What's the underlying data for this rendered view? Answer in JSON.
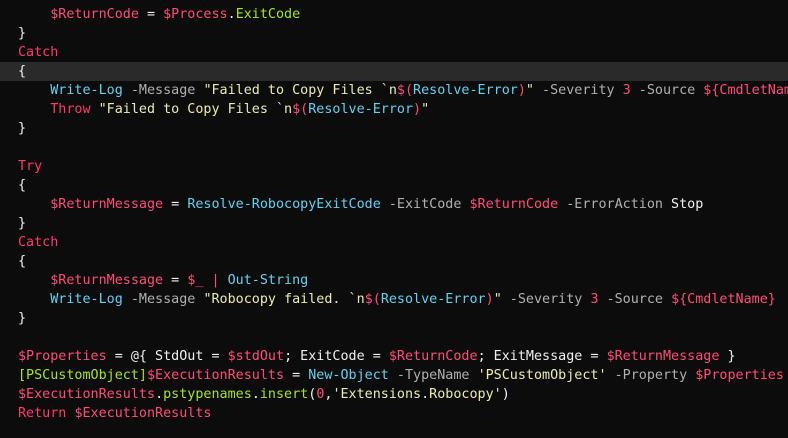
{
  "editor": {
    "current_line": 3,
    "lines": [
      [
        {
          "t": "    ",
          "c": "txt"
        },
        {
          "t": "$ReturnCode",
          "c": "var"
        },
        {
          "t": " = ",
          "c": "txt"
        },
        {
          "t": "$Process",
          "c": "var"
        },
        {
          "t": ".",
          "c": "txt"
        },
        {
          "t": "ExitCode",
          "c": "prop"
        }
      ],
      [
        {
          "t": "}",
          "c": "txt"
        }
      ],
      [
        {
          "t": "Catch",
          "c": "kw"
        }
      ],
      [
        {
          "t": "{",
          "c": "txt"
        }
      ],
      [
        {
          "t": "    ",
          "c": "txt"
        },
        {
          "t": "Write-Log",
          "c": "cmd"
        },
        {
          "t": " -Message ",
          "c": "prm"
        },
        {
          "t": "\"Failed to Copy Files `n",
          "c": "str"
        },
        {
          "t": "$(",
          "c": "strvar"
        },
        {
          "t": "Resolve-Error",
          "c": "strcmd"
        },
        {
          "t": ")",
          "c": "strvar"
        },
        {
          "t": "\"",
          "c": "str"
        },
        {
          "t": " -Severity ",
          "c": "prm"
        },
        {
          "t": "3",
          "c": "num"
        },
        {
          "t": " -Source ",
          "c": "prm"
        },
        {
          "t": "${CmdletName}",
          "c": "var"
        }
      ],
      [
        {
          "t": "    ",
          "c": "txt"
        },
        {
          "t": "Throw",
          "c": "kw"
        },
        {
          "t": " ",
          "c": "txt"
        },
        {
          "t": "\"Failed to Copy Files `n",
          "c": "str"
        },
        {
          "t": "$(",
          "c": "strvar"
        },
        {
          "t": "Resolve-Error",
          "c": "strcmd"
        },
        {
          "t": ")",
          "c": "strvar"
        },
        {
          "t": "\"",
          "c": "str"
        }
      ],
      [
        {
          "t": "}",
          "c": "txt"
        }
      ],
      [],
      [
        {
          "t": "Try",
          "c": "kw"
        }
      ],
      [
        {
          "t": "{",
          "c": "txt"
        }
      ],
      [
        {
          "t": "    ",
          "c": "txt"
        },
        {
          "t": "$ReturnMessage",
          "c": "var"
        },
        {
          "t": " = ",
          "c": "txt"
        },
        {
          "t": "Resolve-RobocopyExitCode",
          "c": "cmd"
        },
        {
          "t": " -ExitCode ",
          "c": "prm"
        },
        {
          "t": "$ReturnCode",
          "c": "var"
        },
        {
          "t": " -ErrorAction ",
          "c": "prm"
        },
        {
          "t": "Stop",
          "c": "txt"
        }
      ],
      [
        {
          "t": "}",
          "c": "txt"
        }
      ],
      [
        {
          "t": "Catch",
          "c": "kw"
        }
      ],
      [
        {
          "t": "{",
          "c": "txt"
        }
      ],
      [
        {
          "t": "    ",
          "c": "txt"
        },
        {
          "t": "$ReturnMessage",
          "c": "var"
        },
        {
          "t": " = ",
          "c": "txt"
        },
        {
          "t": "$_",
          "c": "var"
        },
        {
          "t": " | ",
          "c": "op"
        },
        {
          "t": "Out-String",
          "c": "cmd"
        }
      ],
      [
        {
          "t": "    ",
          "c": "txt"
        },
        {
          "t": "Write-Log",
          "c": "cmd"
        },
        {
          "t": " -Message ",
          "c": "prm"
        },
        {
          "t": "\"Robocopy failed. `n",
          "c": "str"
        },
        {
          "t": "$(",
          "c": "strvar"
        },
        {
          "t": "Resolve-Error",
          "c": "strcmd"
        },
        {
          "t": ")",
          "c": "strvar"
        },
        {
          "t": "\"",
          "c": "str"
        },
        {
          "t": " -Severity ",
          "c": "prm"
        },
        {
          "t": "3",
          "c": "num"
        },
        {
          "t": " -Source ",
          "c": "prm"
        },
        {
          "t": "${CmdletName}",
          "c": "var"
        }
      ],
      [
        {
          "t": "}",
          "c": "txt"
        }
      ],
      [],
      [
        {
          "t": "$Properties",
          "c": "var"
        },
        {
          "t": " = @{ StdOut = ",
          "c": "txt"
        },
        {
          "t": "$stdOut",
          "c": "var"
        },
        {
          "t": "; ExitCode = ",
          "c": "txt"
        },
        {
          "t": "$ReturnCode",
          "c": "var"
        },
        {
          "t": "; ExitMessage = ",
          "c": "txt"
        },
        {
          "t": "$ReturnMessage",
          "c": "var"
        },
        {
          "t": " }",
          "c": "txt"
        }
      ],
      [
        {
          "t": "[PSCustomObject]",
          "c": "typ"
        },
        {
          "t": "$ExecutionResults",
          "c": "var"
        },
        {
          "t": " = ",
          "c": "txt"
        },
        {
          "t": "New-Object",
          "c": "cmd"
        },
        {
          "t": " -TypeName ",
          "c": "prm"
        },
        {
          "t": "'PSCustomObject'",
          "c": "str"
        },
        {
          "t": " -Property ",
          "c": "prm"
        },
        {
          "t": "$Properties",
          "c": "var"
        }
      ],
      [
        {
          "t": "$ExecutionResults",
          "c": "var"
        },
        {
          "t": ".",
          "c": "txt"
        },
        {
          "t": "pstypenames",
          "c": "prop"
        },
        {
          "t": ".",
          "c": "txt"
        },
        {
          "t": "insert",
          "c": "prop"
        },
        {
          "t": "(",
          "c": "txt"
        },
        {
          "t": "0",
          "c": "num"
        },
        {
          "t": ",",
          "c": "txt"
        },
        {
          "t": "'Extensions.Robocopy'",
          "c": "str"
        },
        {
          "t": ")",
          "c": "txt"
        }
      ],
      [
        {
          "t": "Return",
          "c": "kw"
        },
        {
          "t": " ",
          "c": "txt"
        },
        {
          "t": "$ExecutionResults",
          "c": "var"
        }
      ]
    ]
  }
}
